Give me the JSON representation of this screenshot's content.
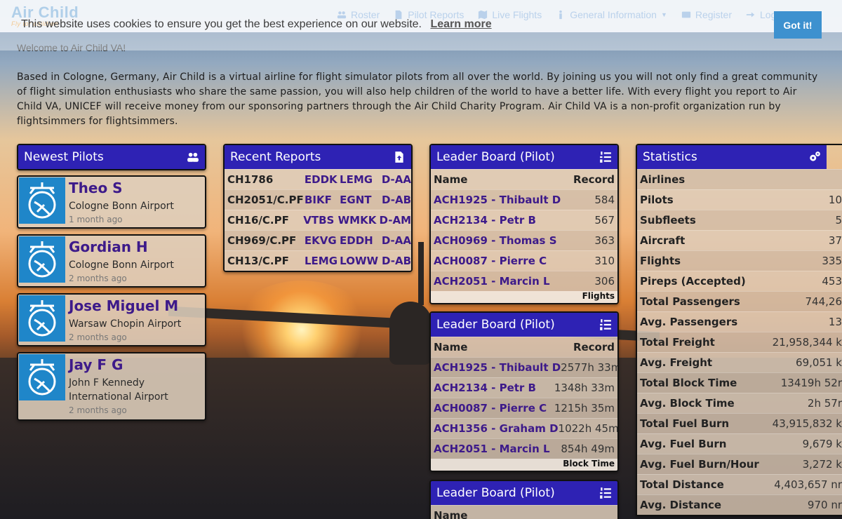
{
  "nav": {
    "brand": "Air Child",
    "brand_tagline": "Fly for children",
    "items": [
      {
        "icon": "users-icon",
        "label": "Roster"
      },
      {
        "icon": "file-icon",
        "label": "Pilot Reports"
      },
      {
        "icon": "map-icon",
        "label": "Live Flights"
      },
      {
        "icon": "info-icon",
        "label": "General Information"
      },
      {
        "icon": "id-card-icon",
        "label": "Register"
      },
      {
        "icon": "sign-in-icon",
        "label": "Log In"
      }
    ]
  },
  "cookie": {
    "text": "This website uses cookies to ensure you get the best experience on our website.",
    "link": "Learn more",
    "button": "Got it!"
  },
  "welcome": "Welcome to Air Child VA!",
  "intro": "Based in Cologne, Germany, Air Child is a virtual airline for flight simulator pilots from all over the world. By joining us you will not only find a great community of flight simulation enthusiasts who share the same passion, you will also help children of the world to have a better life. With every flight you report to Air Child VA, UNICEF will receive money from our sponsoring partners through the Air Child Charity Program. Air Child VA is a non-profit organization run by flightsimmers for flightsimmers.",
  "newest_pilots": {
    "title": "Newest Pilots",
    "pilots": [
      {
        "name": "Theo S",
        "airport": "Cologne Bonn Airport",
        "joined": "1 month ago"
      },
      {
        "name": "Gordian H",
        "airport": "Cologne Bonn Airport",
        "joined": "2 months ago"
      },
      {
        "name": "Jose Miguel M",
        "airport": "Warsaw Chopin Airport",
        "joined": "2 months ago"
      },
      {
        "name": "Jay F G",
        "airport": "John F Kennedy International Airport",
        "joined": "2 months ago"
      }
    ]
  },
  "recent_reports": {
    "title": "Recent Reports",
    "rows": [
      {
        "flight": "CH1786",
        "dep": "EDDK",
        "arr": "LEMG",
        "reg": "D-AA"
      },
      {
        "flight": "CH2051/C.PF",
        "dep": "BIKF",
        "arr": "EGNT",
        "reg": "D-AB"
      },
      {
        "flight": "CH16/C.PF",
        "dep": "VTBS",
        "arr": "WMKK",
        "reg": "D-AM"
      },
      {
        "flight": "CH969/C.PF",
        "dep": "EKVG",
        "arr": "EDDH",
        "reg": "D-AA"
      },
      {
        "flight": "CH13/C.PF",
        "dep": "LEMG",
        "arr": "LOWW",
        "reg": "D-AB"
      }
    ]
  },
  "leader_flights": {
    "title": "Leader Board (Pilot)",
    "col_name": "Name",
    "col_record": "Record",
    "footer": "Flights",
    "rows": [
      {
        "name": "ACH1925 - Thibault D",
        "record": "584"
      },
      {
        "name": "ACH2134 - Petr B",
        "record": "567"
      },
      {
        "name": "ACH0969 - Thomas S",
        "record": "363"
      },
      {
        "name": "ACH0087 - Pierre C",
        "record": "310"
      },
      {
        "name": "ACH2051 - Marcin L",
        "record": "306"
      }
    ]
  },
  "leader_block": {
    "title": "Leader Board (Pilot)",
    "col_name": "Name",
    "col_record": "Record",
    "footer": "Block Time",
    "rows": [
      {
        "name": "ACH1925 - Thibault D",
        "record": "2577h 33m"
      },
      {
        "name": "ACH2134 - Petr B",
        "record": "1348h 33m"
      },
      {
        "name": "ACH0087 - Pierre C",
        "record": "1215h 35m"
      },
      {
        "name": "ACH1356 - Graham D",
        "record": "1022h 45m"
      },
      {
        "name": "ACH2051 - Marcin L",
        "record": "854h 49m"
      }
    ]
  },
  "leader_third": {
    "title": "Leader Board (Pilot)",
    "col_name": "Name"
  },
  "statistics": {
    "title": "Statistics",
    "rows": [
      {
        "label": "Airlines",
        "value": ""
      },
      {
        "label": "Pilots",
        "value": "10"
      },
      {
        "label": "Subfleets",
        "value": "5"
      },
      {
        "label": "Aircraft",
        "value": "37"
      },
      {
        "label": "Flights",
        "value": "335"
      },
      {
        "label": "Pireps (Accepted)",
        "value": "453"
      },
      {
        "label": "Total Passengers",
        "value": "744,26"
      },
      {
        "label": "Avg. Passengers",
        "value": "13"
      },
      {
        "label": "Total Freight",
        "value": "21,958,344 k"
      },
      {
        "label": "Avg. Freight",
        "value": "69,051 k"
      },
      {
        "label": "Total Block Time",
        "value": "13419h 52r"
      },
      {
        "label": "Avg. Block Time",
        "value": "2h 57r"
      },
      {
        "label": "Total Fuel Burn",
        "value": "43,915,832 k"
      },
      {
        "label": "Avg. Fuel Burn",
        "value": "9,679 k"
      },
      {
        "label": "Avg. Fuel Burn/Hour",
        "value": "3,272 k"
      },
      {
        "label": "Total Distance",
        "value": "4,403,657 nr"
      },
      {
        "label": "Avg. Distance",
        "value": "970 nr"
      }
    ]
  }
}
